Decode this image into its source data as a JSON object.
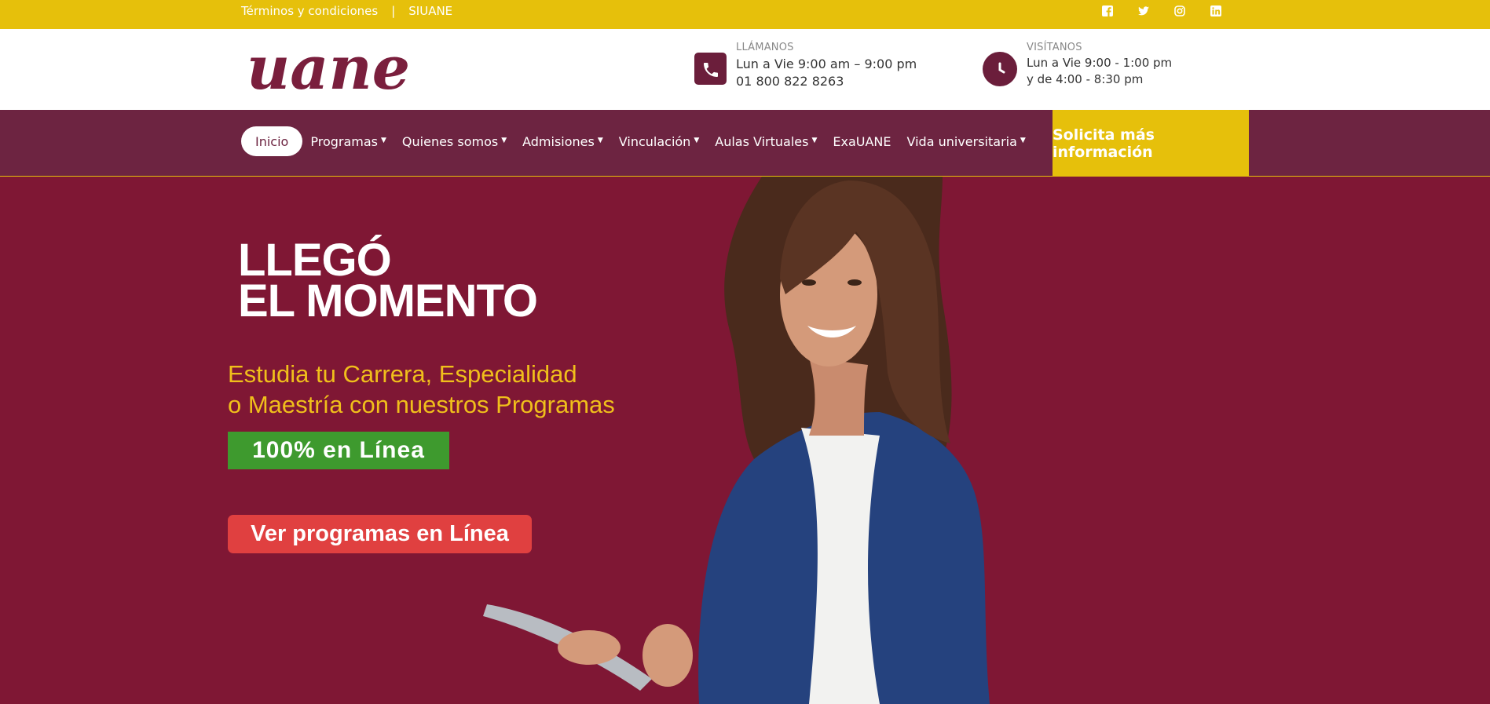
{
  "topbar": {
    "terms": "Términos y condiciones",
    "separator": "|",
    "siuane": "SIUANE",
    "social": [
      "facebook-icon",
      "twitter-icon",
      "instagram-icon",
      "linkedin-icon"
    ]
  },
  "header": {
    "logo_text": "uane",
    "call": {
      "label": "LLÁMANOS",
      "line1": "Lun a Vie 9:00 am – 9:00 pm",
      "line2": "01 800 822 8263"
    },
    "visit": {
      "label": "VISÍTANOS",
      "line1": "Lun a Vie 9:00 - 1:00 pm",
      "line2": "y de 4:00 - 8:30 pm"
    }
  },
  "nav": {
    "items": [
      {
        "label": "Inicio",
        "dropdown": false
      },
      {
        "label": "Programas",
        "dropdown": true
      },
      {
        "label": "Quienes somos",
        "dropdown": true
      },
      {
        "label": "Admisiones",
        "dropdown": true
      },
      {
        "label": "Vinculación",
        "dropdown": true
      },
      {
        "label": "Aulas Virtuales",
        "dropdown": true
      },
      {
        "label": "ExaUANE",
        "dropdown": false
      },
      {
        "label": "Vida universitaria",
        "dropdown": true
      }
    ],
    "cta": "Solicita más información"
  },
  "hero": {
    "title_line1": "LLEGÓ",
    "title_line2": "EL MOMENTO",
    "subtitle_line1": "Estudia tu Carrera, Especialidad",
    "subtitle_line2": "o Maestría con nuestros Programas",
    "badge": "100% en Línea",
    "button": "Ver programas en Línea"
  },
  "colors": {
    "accent_yellow": "#e6c00b",
    "brand_maroon": "#7f1734",
    "nav_maroon": "#6d2441",
    "badge_green": "#3e9a2e",
    "button_red": "#e04040"
  }
}
